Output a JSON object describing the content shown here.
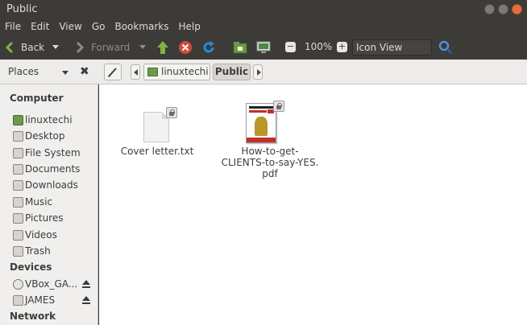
{
  "window": {
    "title": "Public"
  },
  "menu": [
    "File",
    "Edit",
    "View",
    "Go",
    "Bookmarks",
    "Help"
  ],
  "toolbar": {
    "back_label": "Back",
    "forward_label": "Forward",
    "zoom": "100%",
    "view_mode": "Icon View"
  },
  "location": {
    "places_label": "Places",
    "crumbs": [
      "linuxtechi",
      "Public"
    ]
  },
  "sidebar": {
    "computer_heading": "Computer",
    "computer_items": [
      "linuxtechi",
      "Desktop",
      "File System",
      "Documents",
      "Downloads",
      "Music",
      "Pictures",
      "Videos",
      "Trash"
    ],
    "devices_heading": "Devices",
    "device_items": [
      "VBox_GA...",
      "JAMES"
    ],
    "network_heading": "Network"
  },
  "files": [
    {
      "name": "Cover letter.txt"
    },
    {
      "name_lines": [
        "How-to-get-",
        "CLIENTS-to-say-YES.",
        "pdf"
      ]
    }
  ],
  "colors": {
    "titlebar": "#3c3b37",
    "accent_green": "#6b9a4a",
    "close_red": "#e26f3e",
    "reload_blue": "#2a8ad4"
  }
}
